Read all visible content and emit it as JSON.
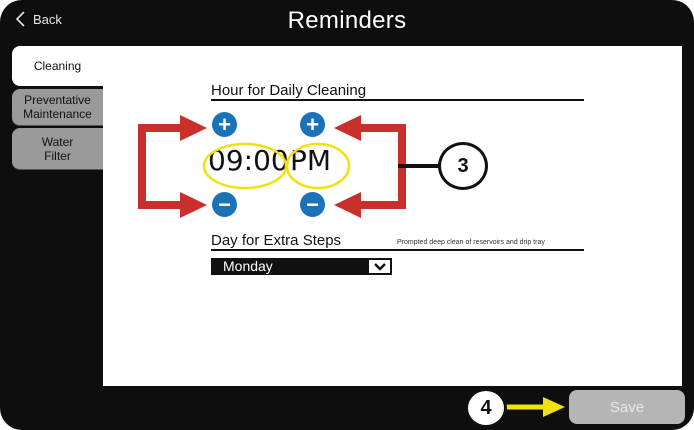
{
  "header": {
    "back_label": "Back",
    "title": "Reminders"
  },
  "sidebar": {
    "items": [
      {
        "label": "Cleaning",
        "active": true
      },
      {
        "label": "Preventative\nMaintenance",
        "active": false
      },
      {
        "label": "Water\nFilter",
        "active": false
      }
    ]
  },
  "cleaning": {
    "hour_label": "Hour for Daily Cleaning",
    "time": "09:00",
    "period": "PM",
    "day_label": "Day for Extra Steps",
    "day_note": "Prompted deep clean of reservoirs and drip tray",
    "day_value": "Monday"
  },
  "footer": {
    "save_label": "Save"
  },
  "annotations": {
    "callout_3": "3",
    "callout_4": "4"
  },
  "colors": {
    "device_bg": "#0e0e0e",
    "button_blue": "#1a73b8",
    "arrow_red": "#c9302c",
    "highlight_yellow": "#f2e10a",
    "tab_inactive": "#9a9a9a"
  },
  "icons": {
    "back": "chevron-left-icon",
    "increment": "plus-circle-icon",
    "decrement": "minus-circle-icon",
    "dropdown": "chevron-down-icon"
  }
}
